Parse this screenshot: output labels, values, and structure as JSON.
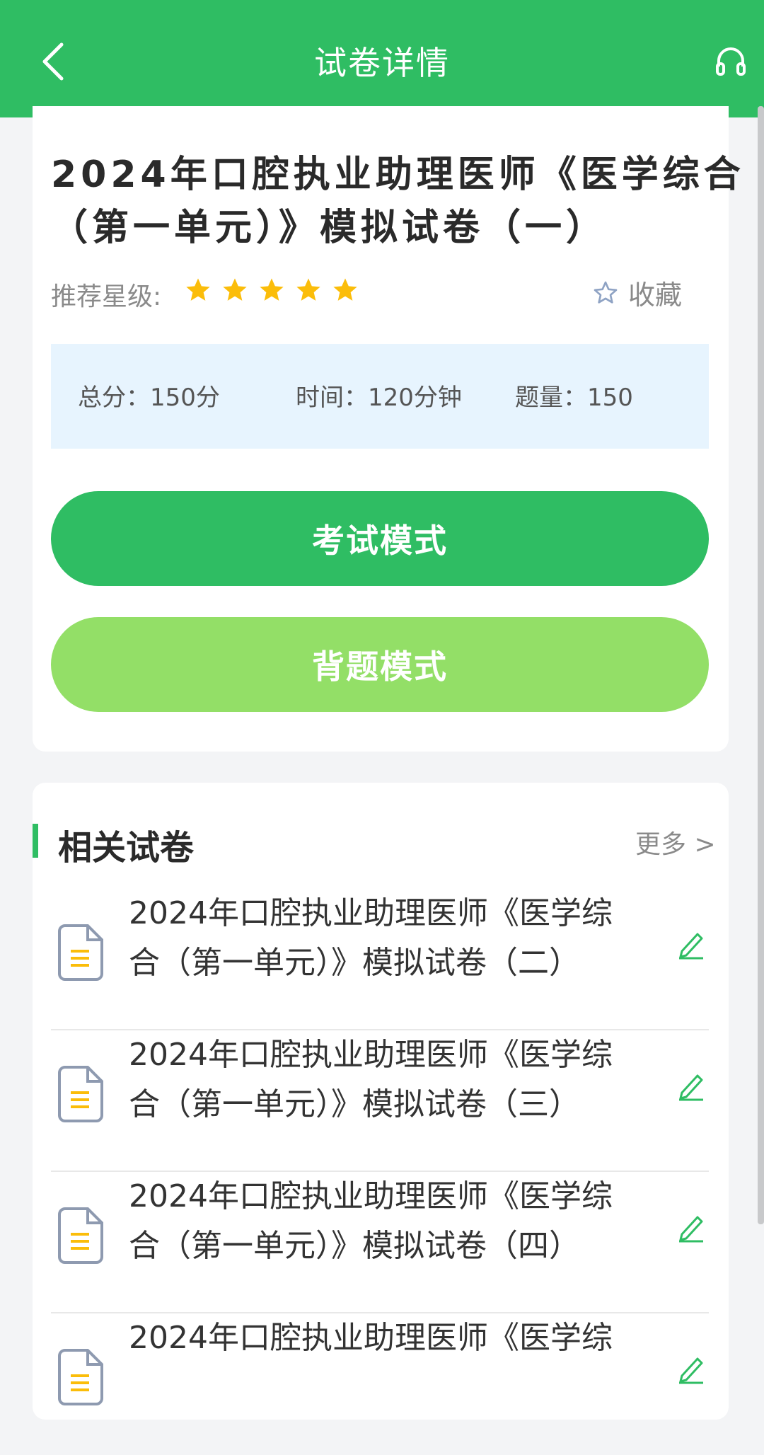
{
  "header": {
    "title": "试卷详情",
    "back_icon": "chevron-left-icon",
    "headset_icon": "headset-icon",
    "bg_color": "#2fbd63"
  },
  "exam": {
    "title": "2024年口腔执业助理医师《医学综合（第一单元）》模拟试卷（一）",
    "rating_label": "推荐星级:",
    "rating": 5,
    "rating_max": 5,
    "star_color": "#fbbd0a",
    "favorite_label": "收藏",
    "total_score": "总分：150分",
    "time": "时间：120分钟",
    "question_count": "题量：150"
  },
  "buttons": {
    "exam_mode": "考试模式",
    "recite_mode": "背题模式"
  },
  "related": {
    "title": "相关试卷",
    "more": "更多 >",
    "items": [
      {
        "label": "2024年口腔执业助理医师《医学综合（第一单元）》模拟试卷（二）"
      },
      {
        "label": "2024年口腔执业助理医师《医学综合（第一单元）》模拟试卷（三）"
      },
      {
        "label": "2024年口腔执业助理医师《医学综合（第一单元）》模拟试卷（四）"
      },
      {
        "label": "2024年口腔执业助理医师《医学综"
      }
    ]
  }
}
